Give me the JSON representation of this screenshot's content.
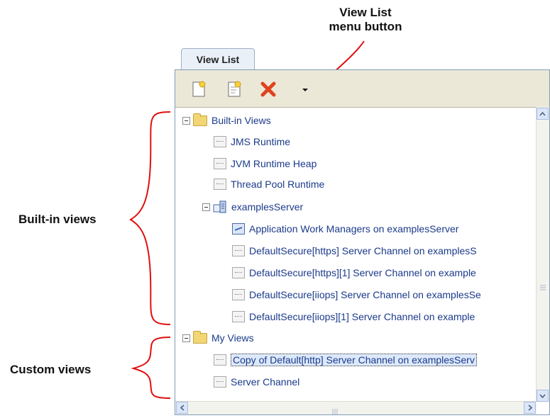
{
  "annotations": {
    "menu_button_line1": "View List",
    "menu_button_line2": "menu button",
    "builtin_views": "Built-in views",
    "custom_views": "Custom views"
  },
  "tab": {
    "label": "View List"
  },
  "toolbar": {
    "buttons": [
      "new-view-icon",
      "new-folder-icon",
      "delete-icon",
      "menu-dropdown-icon"
    ]
  },
  "tree": {
    "builtin_folder": "Built-in Views",
    "builtin_items": [
      "JMS Runtime",
      "JVM Runtime Heap",
      "Thread Pool Runtime"
    ],
    "server_node": "examplesServer",
    "server_items": [
      "Application Work Managers on examplesServer",
      "DefaultSecure[https] Server Channel on examplesS",
      "DefaultSecure[https][1] Server Channel on example",
      "DefaultSecure[iiops] Server Channel on examplesSe",
      "DefaultSecure[iiops][1] Server Channel on example"
    ],
    "myviews_folder": "My Views",
    "myviews_items": [
      "Copy of Default[http] Server Channel on examplesServ",
      "Server Channel"
    ]
  },
  "colors": {
    "annotation_red": "#e01010",
    "tree_text": "#1b3a8a",
    "toolbar_bg": "#ece8d8"
  }
}
